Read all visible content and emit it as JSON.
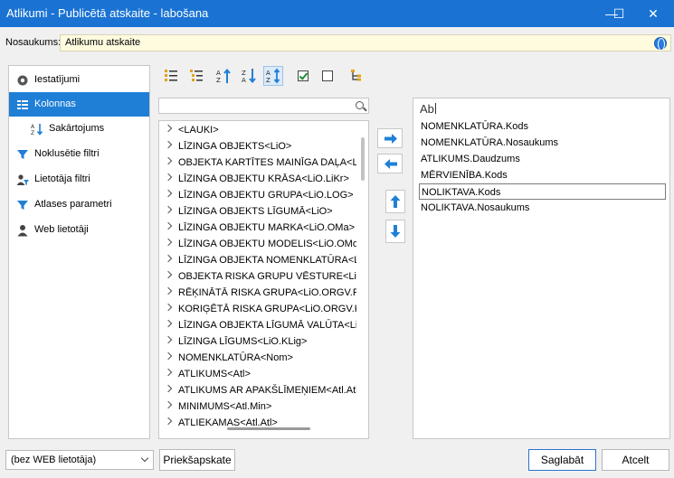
{
  "window": {
    "title": "Atlikumi - Publicētā atskaite - labošana",
    "minimize": "—",
    "maximize": "☐",
    "close": "✕"
  },
  "name_row": {
    "label": "Nosaukums:",
    "value": "Atlikumu atskaite"
  },
  "sidebar": {
    "items": [
      {
        "label": "Iestatījumi",
        "icon": "gear-icon"
      },
      {
        "label": "Kolonnas",
        "icon": "columns-icon",
        "active": true
      },
      {
        "label": "Sakārtojums",
        "icon": "sort-az-icon"
      },
      {
        "label": "Noklusētie filtri",
        "icon": "filter-icon"
      },
      {
        "label": "Lietotāja filtri",
        "icon": "user-filter-icon"
      },
      {
        "label": "Atlases parametri",
        "icon": "funnel-icon"
      },
      {
        "label": "Web lietotāji",
        "icon": "user-icon"
      }
    ]
  },
  "toolbar": {
    "buttons": [
      {
        "name": "expand-tree-icon"
      },
      {
        "name": "collapse-tree-icon"
      },
      {
        "name": "sort-ascending-icon",
        "label": "A↑"
      },
      {
        "name": "sort-descending-icon",
        "label": "Z↓"
      },
      {
        "name": "sort-az-icon",
        "label": "AZ",
        "pressed": true
      },
      {
        "name": "check-all-icon"
      },
      {
        "name": "uncheck-all-icon"
      },
      {
        "name": "hierarchy-icon"
      }
    ]
  },
  "available_fields": [
    "<LAUKI>",
    "LĪZINGA OBJEKTS<LiO>",
    "OBJEKTA KARTĪTES MAINĪGA DAĻA<LiO",
    "LĪZINGA OBJEKTU KRĀSA<LiO.LiKr>",
    "LĪZINGA OBJEKTU GRUPA<LiO.LOG>",
    "LĪZINGA OBJEKTS LĪGUMĀ<LiO>",
    "LĪZINGA OBJEKTU MARKA<LiO.OMa>",
    "LĪZINGA OBJEKTU MODELIS<LiO.OMo>",
    "LĪZINGA OBJEKTA NOMENKLATŪRA<LiO.",
    "OBJEKTA RISKA GRUPU VĒSTURE<LiO.C",
    "RĒĶINĀTĀ RISKA GRUPA<LiO.ORGV.Rel",
    "KORIĢĒTĀ RISKA GRUPA<LiO.ORGV.Kol",
    "LĪZINGA OBJEKTA LĪGUMĀ VALŪTA<LiO",
    "LĪZINGA LĪGUMS<LiO.KLig>",
    "NOMENKLATŪRA<Nom>",
    "ATLIKUMS<Atl>",
    "ATLIKUMS AR APAKŠLĪMEŅIEM<Atl.AtlA",
    "MINIMUMS<Atl.Min>",
    "ATLIEKAMAS<Atl.Atl>"
  ],
  "selected_columns": {
    "search_value": "Ab",
    "items": [
      {
        "label": "NOMENKLATŪRA.Kods"
      },
      {
        "label": "NOMENKLATŪRA.Nosaukums"
      },
      {
        "label": "ATLIKUMS.Daudzums"
      },
      {
        "label": "MĒRVIENĪBA.Kods"
      },
      {
        "label": "NOLIKTAVA.Kods",
        "selected": true
      },
      {
        "label": "NOLIKTAVA.Nosaukums"
      }
    ]
  },
  "footer": {
    "web_user_combo": "(bez WEB lietotāja)",
    "preview_label": "Priekšapskate",
    "save_label": "Saglabāt",
    "cancel_label": "Atcelt"
  },
  "colors": {
    "title_bar": "#1a73d3",
    "active_nav": "#1f7fd6",
    "name_field_bg": "#fffbdf",
    "arrow_blue": "#1f7fd6"
  }
}
